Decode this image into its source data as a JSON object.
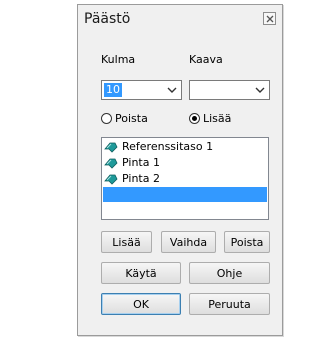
{
  "dialog": {
    "title": "Päästö",
    "close_icon": "close-icon"
  },
  "angle": {
    "label": "Kulma",
    "value": "10"
  },
  "formula": {
    "label": "Kaava",
    "value": ""
  },
  "mode": {
    "options": [
      {
        "label": "Poista",
        "selected": false
      },
      {
        "label": "Lisää",
        "selected": true
      }
    ]
  },
  "list": {
    "items": [
      {
        "label": "Referenssitaso 1",
        "icon": "plane-icon"
      },
      {
        "label": "Pinta 1",
        "icon": "surface-icon"
      },
      {
        "label": "Pinta 2",
        "icon": "surface-icon"
      }
    ],
    "selected_index": 3
  },
  "buttons": {
    "add": "Lisää",
    "replace": "Vaihda",
    "remove": "Poista",
    "apply": "Käytä",
    "help": "Ohje",
    "ok": "OK",
    "cancel": "Peruuta"
  },
  "colors": {
    "selection": "#3399ff",
    "icon": "#1f9a9a"
  }
}
